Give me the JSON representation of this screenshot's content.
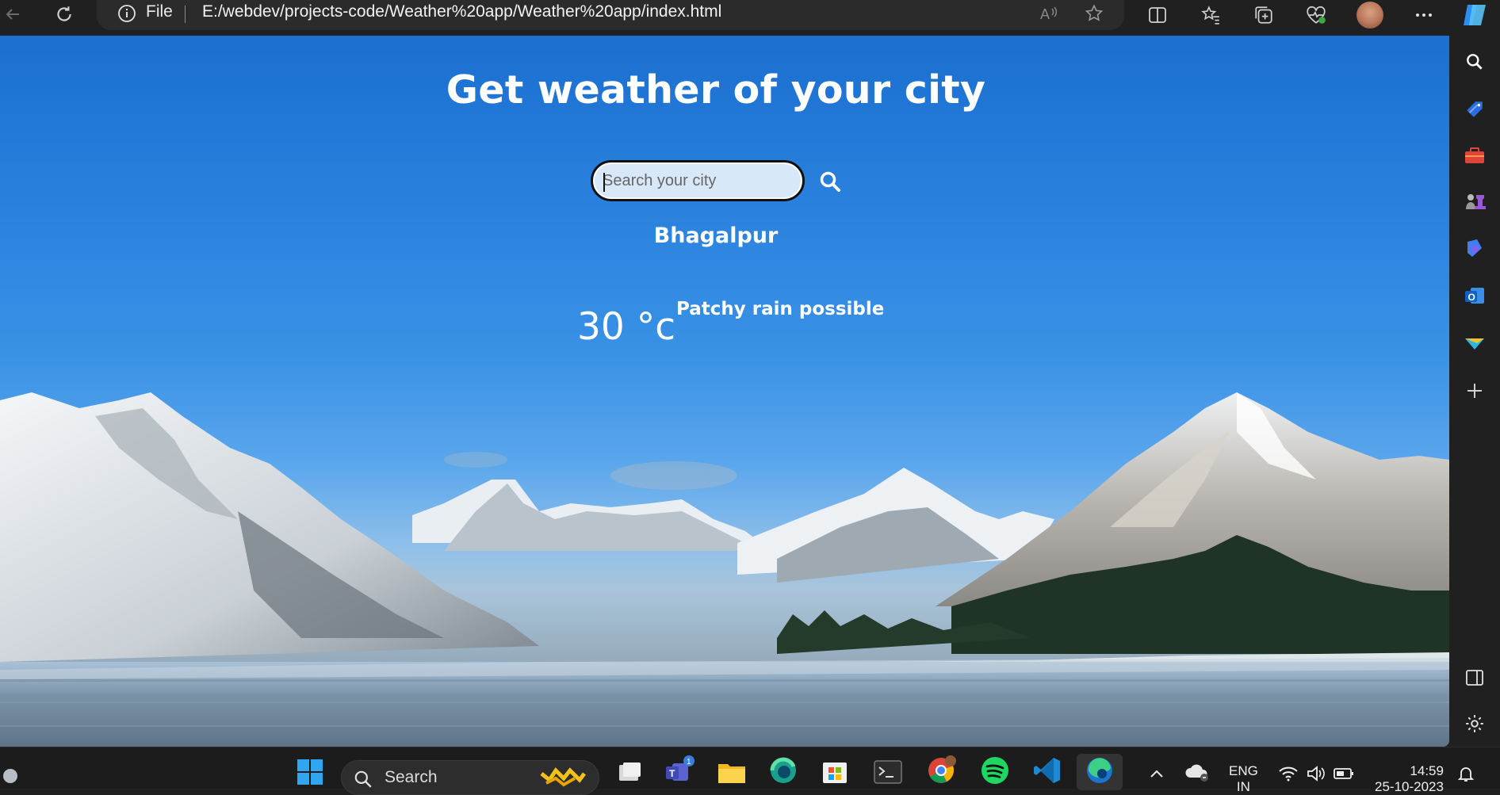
{
  "browser": {
    "protocol_label": "File",
    "url": "E:/webdev/projects-code/Weather%20app/Weather%20app/index.html"
  },
  "page": {
    "title": "Get weather of your city",
    "search": {
      "placeholder": "Search your city",
      "value": ""
    },
    "city": "Bhagalpur",
    "temperature": "30 °c",
    "condition": "Patchy rain possible"
  },
  "taskbar": {
    "search_label": "Search",
    "teams_badge": "1",
    "language_line1": "ENG",
    "language_line2": "IN",
    "time": "14:59",
    "date": "25-10-2023"
  },
  "colors": {
    "sky_top": "#1b6fcf",
    "sky_mid": "#3a92e6",
    "browser_chrome": "#202020",
    "search_bg": "#d8e8f8",
    "text": "#ffffff"
  },
  "icons": {
    "toolbar": [
      "back-icon",
      "refresh-icon",
      "info-icon",
      "read-aloud-icon",
      "favorite-star-icon",
      "split-screen-icon",
      "favorites-icon",
      "collections-icon",
      "performance-icon",
      "profile-avatar",
      "more-icon",
      "copilot-icon"
    ],
    "sidebar": [
      "search-icon",
      "shopping-tag-icon",
      "tools-icon",
      "games-icon",
      "copilot-sidebar-icon",
      "outlook-icon",
      "drop-icon",
      "add-icon",
      "sidebar-toggle-icon",
      "settings-icon"
    ],
    "taskbar": [
      "windows-start-icon",
      "search-icon",
      "task-view-icon",
      "teams-icon",
      "file-explorer-icon",
      "edge-dev-icon",
      "store-icon",
      "terminal-icon",
      "chrome-icon",
      "spotify-icon",
      "vscode-icon",
      "edge-icon",
      "chevron-up-icon",
      "onedrive-icon",
      "wifi-icon",
      "volume-icon",
      "battery-icon",
      "notification-bell-icon"
    ]
  }
}
